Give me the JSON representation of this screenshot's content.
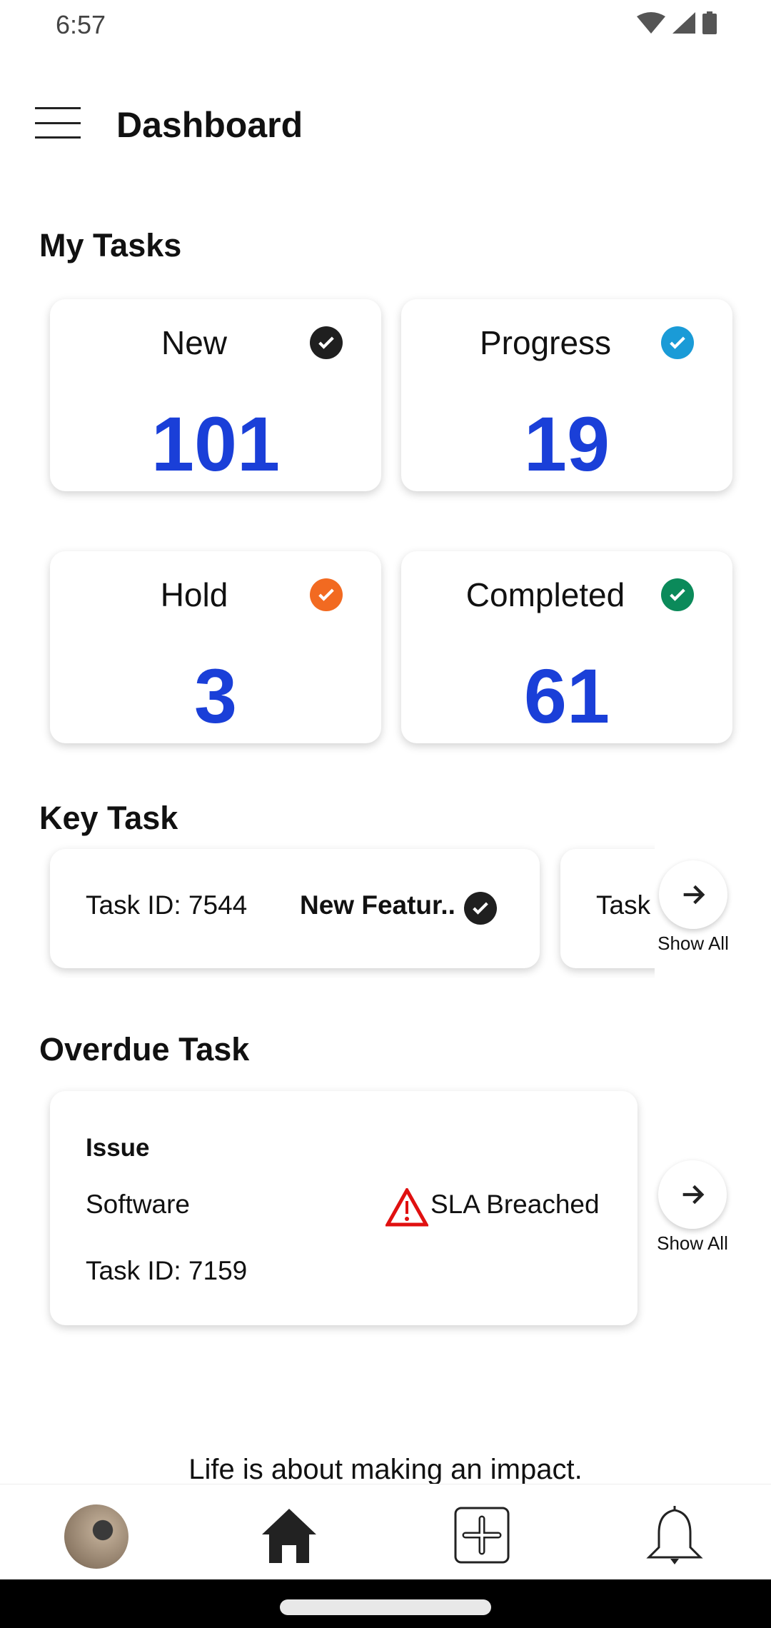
{
  "status_bar": {
    "time": "6:57"
  },
  "header": {
    "title": "Dashboard"
  },
  "my_tasks": {
    "heading": "My Tasks",
    "cards": [
      {
        "label": "New",
        "count": "101",
        "icon_color": "#1f1f1f"
      },
      {
        "label": "Progress",
        "count": "19",
        "icon_color": "#1a9bd7"
      },
      {
        "label": "Hold",
        "count": "3",
        "icon_color": "#f26a21"
      },
      {
        "label": "Completed",
        "count": "61",
        "icon_color": "#0b8a5a"
      }
    ]
  },
  "key_task": {
    "heading": "Key Task",
    "cards": [
      {
        "task_id": "Task ID: 7544",
        "type": "New Featur.."
      },
      {
        "task_id": "Task"
      }
    ],
    "show_all": "Show All"
  },
  "overdue_task": {
    "heading": "Overdue Task",
    "card": {
      "title": "Issue",
      "category": "Software",
      "status": "SLA Breached",
      "task_id": "Task ID: 7159"
    },
    "show_all": "Show All"
  },
  "quote": "Life is about making an impact.",
  "colors": {
    "accent": "#1a3fd8",
    "warning": "#e01010"
  },
  "nav": [
    "profile-avatar",
    "home-icon",
    "add-icon",
    "bell-icon"
  ]
}
